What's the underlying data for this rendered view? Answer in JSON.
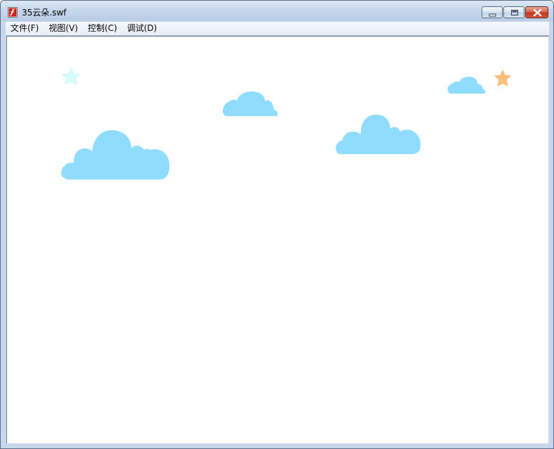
{
  "window": {
    "title": "35云朵.swf",
    "app_icon": "flash-player-icon",
    "buttons": {
      "minimize_icon": "minimize-icon",
      "maximize_icon": "maximize-icon",
      "close_icon": "close-icon"
    }
  },
  "menubar": {
    "items": [
      {
        "label": "文件(F)"
      },
      {
        "label": "视图(V)"
      },
      {
        "label": "控制(C)"
      },
      {
        "label": "调试(D)"
      }
    ]
  },
  "stage": {
    "background": "#ffffff",
    "cloud_color": "#8fdcff",
    "star_colors": {
      "left_star": "#d6fbfb",
      "right_star": "#ffbe7c"
    },
    "elements": [
      "cloud-large",
      "cloud-middle",
      "cloud-right",
      "cloud-small",
      "star-left",
      "star-right"
    ]
  }
}
